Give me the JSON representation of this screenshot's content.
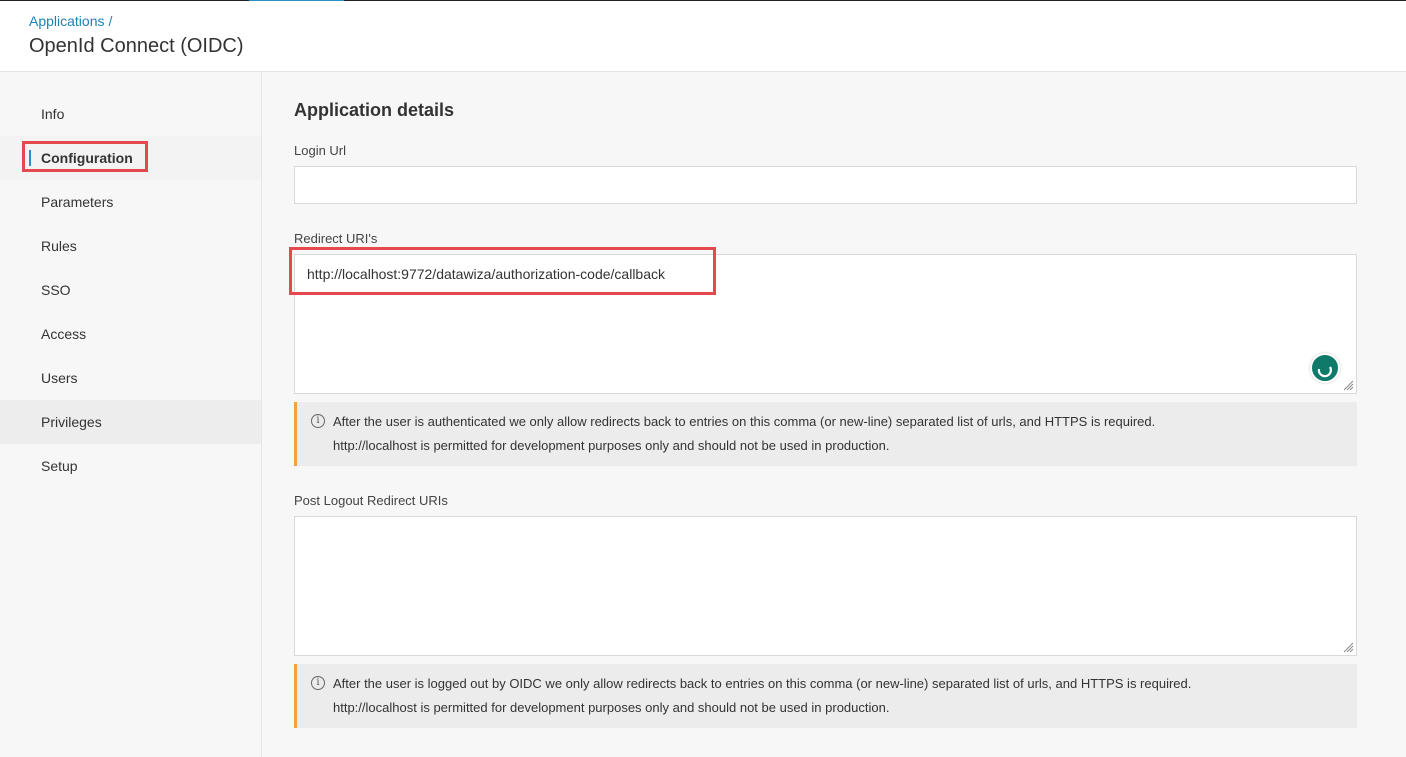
{
  "header": {
    "breadcrumb": "Applications",
    "breadcrumb_sep": "/",
    "title": "OpenId Connect (OIDC)"
  },
  "sidebar": {
    "items": [
      {
        "label": "Info"
      },
      {
        "label": "Configuration"
      },
      {
        "label": "Parameters"
      },
      {
        "label": "Rules"
      },
      {
        "label": "SSO"
      },
      {
        "label": "Access"
      },
      {
        "label": "Users"
      },
      {
        "label": "Privileges"
      },
      {
        "label": "Setup"
      }
    ],
    "active": "Configuration"
  },
  "main": {
    "section_title": "Application details",
    "login_url": {
      "label": "Login Url",
      "value": ""
    },
    "redirect_uris": {
      "label": "Redirect URI's",
      "value": "http://localhost:9772/datawiza/authorization-code/callback",
      "info_line1": "After the user is authenticated we only allow redirects back to entries on this comma (or new-line) separated list of urls, and HTTPS is required.",
      "info_line2": "http://localhost is permitted for development purposes only and should not be used in production."
    },
    "post_logout": {
      "label": "Post Logout Redirect URIs",
      "value": "",
      "info_line1": "After the user is logged out by OIDC we only allow redirects back to entries on this comma (or new-line) separated list of urls, and HTTPS is required.",
      "info_line2": "http://localhost is permitted for development purposes only and should not be used in production."
    }
  },
  "icons": {
    "info": "info-icon",
    "grammarly": "grammarly-icon",
    "resize": "resize-handle-icon"
  },
  "colors": {
    "link": "#1a82b8",
    "highlight": "#e5484d",
    "info_accent": "#f0a23c",
    "active_bar": "#2c8ec9"
  }
}
